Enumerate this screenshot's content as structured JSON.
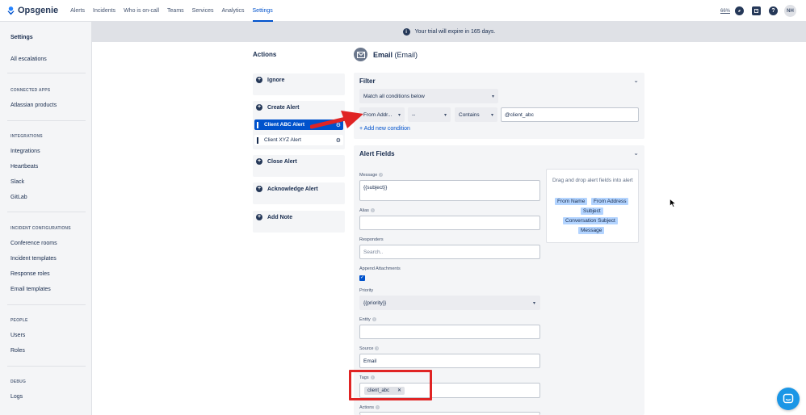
{
  "app": {
    "name": "Opsgenie"
  },
  "nav": {
    "items": [
      "Alerts",
      "Incidents",
      "Who is on-call",
      "Teams",
      "Services",
      "Analytics",
      "Settings"
    ],
    "active": "Settings",
    "zoom": "66%",
    "user_initials": "NH"
  },
  "sidebar": {
    "title": "Settings",
    "all_escalations": "All escalations",
    "connected_apps_head": "CONNECTED APPS",
    "atlassian_products": "Atlassian products",
    "integrations_head": "INTEGRATIONS",
    "integrations": "Integrations",
    "heartbeats": "Heartbeats",
    "slack": "Slack",
    "gitlab": "GitLab",
    "incident_config_head": "INCIDENT CONFIGURATIONS",
    "conference_rooms": "Conference rooms",
    "incident_templates": "Incident templates",
    "response_roles": "Response roles",
    "email_templates": "Email templates",
    "people_head": "PEOPLE",
    "users": "Users",
    "roles": "Roles",
    "debug_head": "DEBUG",
    "logs": "Logs"
  },
  "banner": {
    "text": "Your trial will expire in 165 days."
  },
  "actions": {
    "title": "Actions",
    "ignore": "Ignore",
    "create_alert": "Create Alert",
    "rule_active": "Client ABC Alert",
    "rule_inactive": "Client XYZ Alert",
    "close_alert": "Close Alert",
    "acknowledge_alert": "Acknowledge Alert",
    "add_note": "Add Note"
  },
  "integration": {
    "name": "Email",
    "type": "(Email)"
  },
  "filter": {
    "title": "Filter",
    "match": "Match all conditions below",
    "condition_field": "From Addr...",
    "condition_not": "--",
    "condition_op": "Contains",
    "condition_value": "@client_abc",
    "add_condition": "+ Add new condition"
  },
  "alert_fields": {
    "title": "Alert Fields",
    "message_label": "Message",
    "message_value": "{{subject}}",
    "alias_label": "Alias",
    "responders_label": "Responders",
    "responders_placeholder": "Search..",
    "append_label": "Append Attachments",
    "priority_label": "Priority",
    "priority_value": "{{priority}}",
    "entity_label": "Entity",
    "source_label": "Source",
    "source_value": "Email",
    "tags_label": "Tags",
    "tag_value": "client_abc",
    "actions_label": "Actions"
  },
  "drag_panel": {
    "hint": "Drag and drop alert fields into alert",
    "chips": [
      "From Name",
      "From Address",
      "Subject",
      "Conversation Subject",
      "Message"
    ]
  },
  "colors": {
    "primary": "#0052cc",
    "annotation_red": "#e02424",
    "help_button": "#1b96e6"
  }
}
